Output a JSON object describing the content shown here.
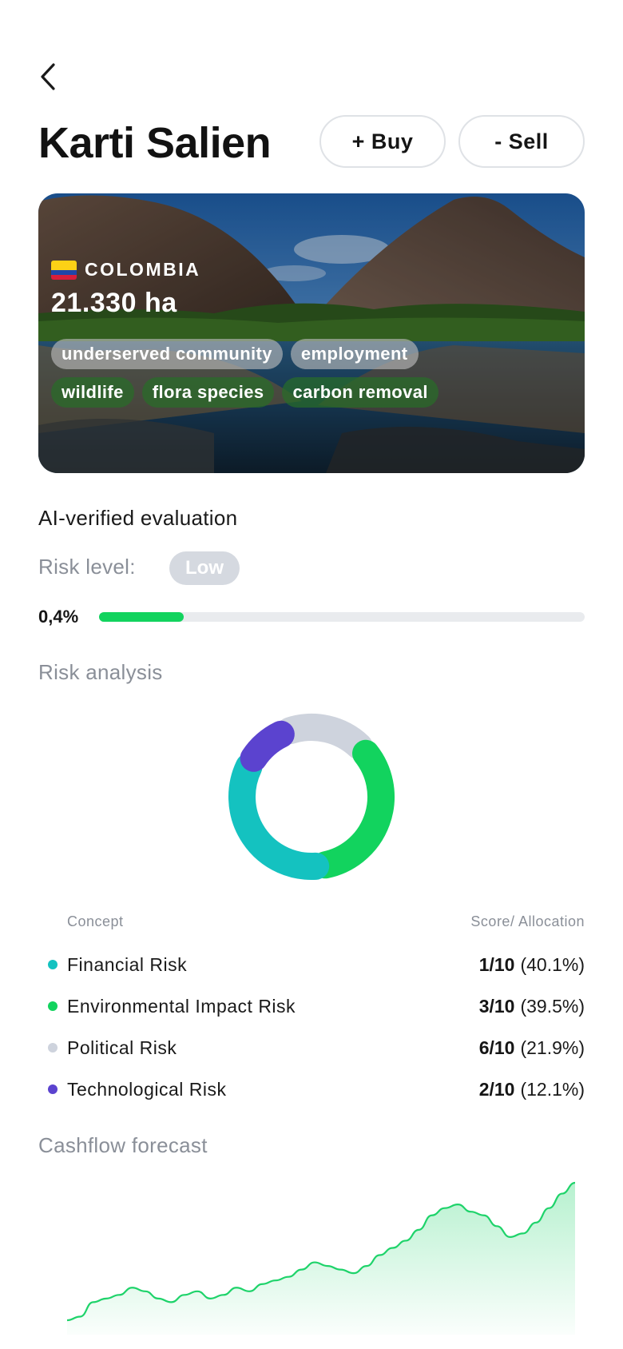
{
  "header": {
    "title": "Karti Salien",
    "buy_label": "+ Buy",
    "sell_label": "- Sell"
  },
  "hero": {
    "country": "COLOMBIA",
    "area": "21.330 ha",
    "tags_row1": [
      "underserved community",
      "employment"
    ],
    "tags_row2": [
      "wildlife",
      "flora species",
      "carbon removal"
    ]
  },
  "evaluation": {
    "title": "AI-verified evaluation",
    "risk_label": "Risk level:",
    "risk_value": "Low",
    "percent_label": "0,4%",
    "bar_fill_fraction": 0.175
  },
  "risk_analysis": {
    "title": "Risk analysis",
    "col_concept": "Concept",
    "col_score": "Score/ Allocation",
    "items": [
      {
        "name": "Financial Risk",
        "score": "1/10",
        "alloc": "(40.1%)",
        "color": "#14c2c0"
      },
      {
        "name": "Environmental Impact Risk",
        "score": "3/10",
        "alloc": "(39.5%)",
        "color": "#12d35e"
      },
      {
        "name": "Political Risk",
        "score": "6/10",
        "alloc": "(21.9%)",
        "color": "#ced3dd"
      },
      {
        "name": "Technological Risk",
        "score": "2/10",
        "alloc": "(12.1%)",
        "color": "#5b43cf"
      }
    ]
  },
  "cashflow": {
    "title": "Cashflow forecast",
    "line_color": "#1ed36a",
    "values": [
      0,
      2,
      10,
      12,
      14,
      18,
      16,
      12,
      10,
      14,
      16,
      12,
      14,
      18,
      16,
      20,
      22,
      24,
      28,
      32,
      30,
      28,
      26,
      30,
      36,
      40,
      44,
      50,
      58,
      62,
      64,
      60,
      58,
      52,
      46,
      48,
      54,
      62,
      70,
      76
    ]
  }
}
